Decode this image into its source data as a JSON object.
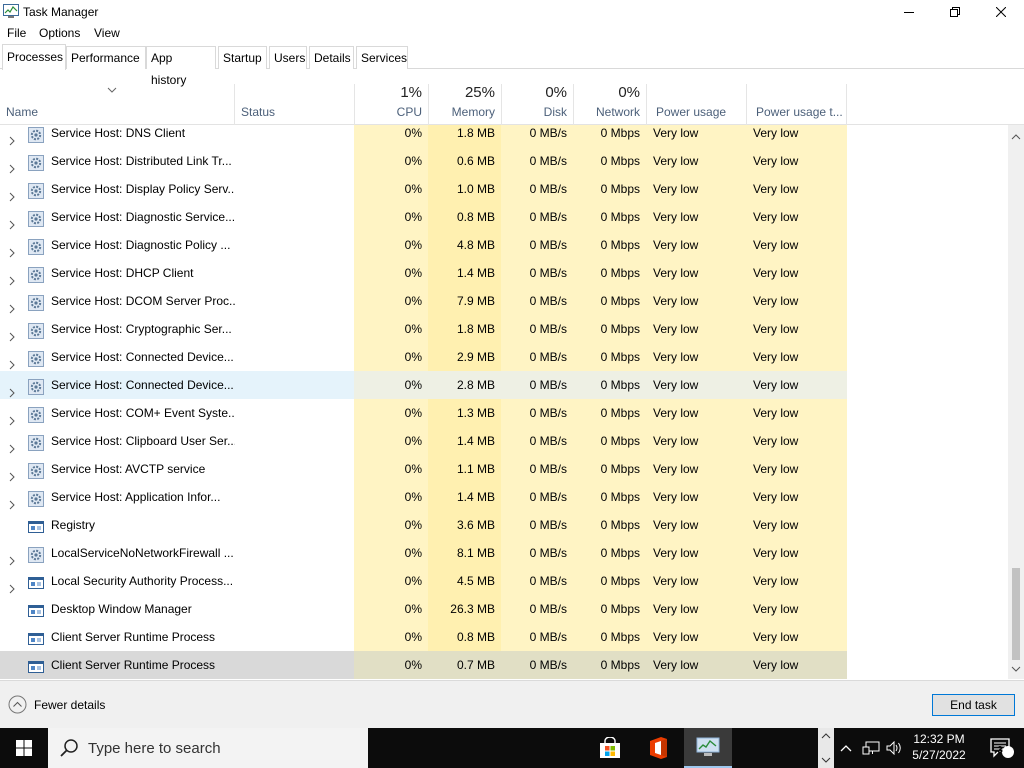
{
  "window": {
    "title": "Task Manager"
  },
  "menu": [
    "File",
    "Options",
    "View"
  ],
  "tabs": [
    "Processes",
    "Performance",
    "App history",
    "Startup",
    "Users",
    "Details",
    "Services"
  ],
  "header": {
    "name": "Name",
    "status": "Status",
    "cpu": {
      "pct": "1%",
      "label": "CPU"
    },
    "memory": {
      "pct": "25%",
      "label": "Memory"
    },
    "disk": {
      "pct": "0%",
      "label": "Disk"
    },
    "network": {
      "pct": "0%",
      "label": "Network"
    },
    "power": "Power usage",
    "power_trend": "Power usage t..."
  },
  "processes": [
    {
      "name": "Service Host: DNS Client",
      "icon": "gear-icon",
      "expandable": true,
      "cpu": "0%",
      "memory": "1.8 MB",
      "disk": "0 MB/s",
      "network": "0 Mbps",
      "power": "Very low",
      "power_trend": "Very low"
    },
    {
      "name": "Service Host: Distributed Link Tr...",
      "icon": "gear-icon",
      "expandable": true,
      "cpu": "0%",
      "memory": "0.6 MB",
      "disk": "0 MB/s",
      "network": "0 Mbps",
      "power": "Very low",
      "power_trend": "Very low"
    },
    {
      "name": "Service Host: Display Policy Serv...",
      "icon": "gear-icon",
      "expandable": true,
      "cpu": "0%",
      "memory": "1.0 MB",
      "disk": "0 MB/s",
      "network": "0 Mbps",
      "power": "Very low",
      "power_trend": "Very low"
    },
    {
      "name": "Service Host: Diagnostic Service...",
      "icon": "gear-icon",
      "expandable": true,
      "cpu": "0%",
      "memory": "0.8 MB",
      "disk": "0 MB/s",
      "network": "0 Mbps",
      "power": "Very low",
      "power_trend": "Very low"
    },
    {
      "name": "Service Host: Diagnostic Policy ...",
      "icon": "gear-icon",
      "expandable": true,
      "cpu": "0%",
      "memory": "4.8 MB",
      "disk": "0 MB/s",
      "network": "0 Mbps",
      "power": "Very low",
      "power_trend": "Very low"
    },
    {
      "name": "Service Host: DHCP Client",
      "icon": "gear-icon",
      "expandable": true,
      "cpu": "0%",
      "memory": "1.4 MB",
      "disk": "0 MB/s",
      "network": "0 Mbps",
      "power": "Very low",
      "power_trend": "Very low"
    },
    {
      "name": "Service Host: DCOM Server Proc...",
      "icon": "gear-icon",
      "expandable": true,
      "cpu": "0%",
      "memory": "7.9 MB",
      "disk": "0 MB/s",
      "network": "0 Mbps",
      "power": "Very low",
      "power_trend": "Very low"
    },
    {
      "name": "Service Host: Cryptographic Ser...",
      "icon": "gear-icon",
      "expandable": true,
      "cpu": "0%",
      "memory": "1.8 MB",
      "disk": "0 MB/s",
      "network": "0 Mbps",
      "power": "Very low",
      "power_trend": "Very low"
    },
    {
      "name": "Service Host: Connected Device...",
      "icon": "gear-icon",
      "expandable": true,
      "cpu": "0%",
      "memory": "2.9 MB",
      "disk": "0 MB/s",
      "network": "0 Mbps",
      "power": "Very low",
      "power_trend": "Very low"
    },
    {
      "name": "Service Host: Connected Device...",
      "icon": "gear-icon",
      "expandable": true,
      "cpu": "0%",
      "memory": "2.8 MB",
      "disk": "0 MB/s",
      "network": "0 Mbps",
      "power": "Very low",
      "power_trend": "Very low",
      "state": "hover"
    },
    {
      "name": "Service Host: COM+ Event Syste...",
      "icon": "gear-icon",
      "expandable": true,
      "cpu": "0%",
      "memory": "1.3 MB",
      "disk": "0 MB/s",
      "network": "0 Mbps",
      "power": "Very low",
      "power_trend": "Very low"
    },
    {
      "name": "Service Host: Clipboard User Ser...",
      "icon": "gear-icon",
      "expandable": true,
      "cpu": "0%",
      "memory": "1.4 MB",
      "disk": "0 MB/s",
      "network": "0 Mbps",
      "power": "Very low",
      "power_trend": "Very low"
    },
    {
      "name": "Service Host: AVCTP service",
      "icon": "gear-icon",
      "expandable": true,
      "cpu": "0%",
      "memory": "1.1 MB",
      "disk": "0 MB/s",
      "network": "0 Mbps",
      "power": "Very low",
      "power_trend": "Very low"
    },
    {
      "name": "Service Host: Application Infor...",
      "icon": "gear-icon",
      "expandable": true,
      "cpu": "0%",
      "memory": "1.4 MB",
      "disk": "0 MB/s",
      "network": "0 Mbps",
      "power": "Very low",
      "power_trend": "Very low"
    },
    {
      "name": "Registry",
      "icon": "window-app-icon",
      "expandable": false,
      "cpu": "0%",
      "memory": "3.6 MB",
      "disk": "0 MB/s",
      "network": "0 Mbps",
      "power": "Very low",
      "power_trend": "Very low"
    },
    {
      "name": "LocalServiceNoNetworkFirewall ...",
      "icon": "gear-icon",
      "expandable": true,
      "cpu": "0%",
      "memory": "8.1 MB",
      "disk": "0 MB/s",
      "network": "0 Mbps",
      "power": "Very low",
      "power_trend": "Very low"
    },
    {
      "name": "Local Security Authority Process...",
      "icon": "window-app-icon",
      "expandable": true,
      "cpu": "0%",
      "memory": "4.5 MB",
      "disk": "0 MB/s",
      "network": "0 Mbps",
      "power": "Very low",
      "power_trend": "Very low"
    },
    {
      "name": "Desktop Window Manager",
      "icon": "window-app-icon",
      "expandable": false,
      "cpu": "0%",
      "memory": "26.3 MB",
      "disk": "0 MB/s",
      "network": "0 Mbps",
      "power": "Very low",
      "power_trend": "Very low"
    },
    {
      "name": "Client Server Runtime Process",
      "icon": "window-app-icon",
      "expandable": false,
      "cpu": "0%",
      "memory": "0.8 MB",
      "disk": "0 MB/s",
      "network": "0 Mbps",
      "power": "Very low",
      "power_trend": "Very low"
    },
    {
      "name": "Client Server Runtime Process",
      "icon": "window-app-icon",
      "expandable": false,
      "cpu": "0%",
      "memory": "0.7 MB",
      "disk": "0 MB/s",
      "network": "0 Mbps",
      "power": "Very low",
      "power_trend": "Very low",
      "state": "selected"
    }
  ],
  "footer": {
    "fewer_details": "Fewer details",
    "end_task": "End task"
  },
  "taskbar": {
    "search_placeholder": "Type here to search",
    "time": "12:32 PM",
    "date": "5/27/2022",
    "notification_count": "3"
  },
  "colors": {
    "cpu_bg": "#fff4c4",
    "memory_bg": "#fff0b0",
    "hover_bg": "#e5f3fb",
    "selected_bg": "#d9d9d9",
    "accent": "#0078d7"
  }
}
